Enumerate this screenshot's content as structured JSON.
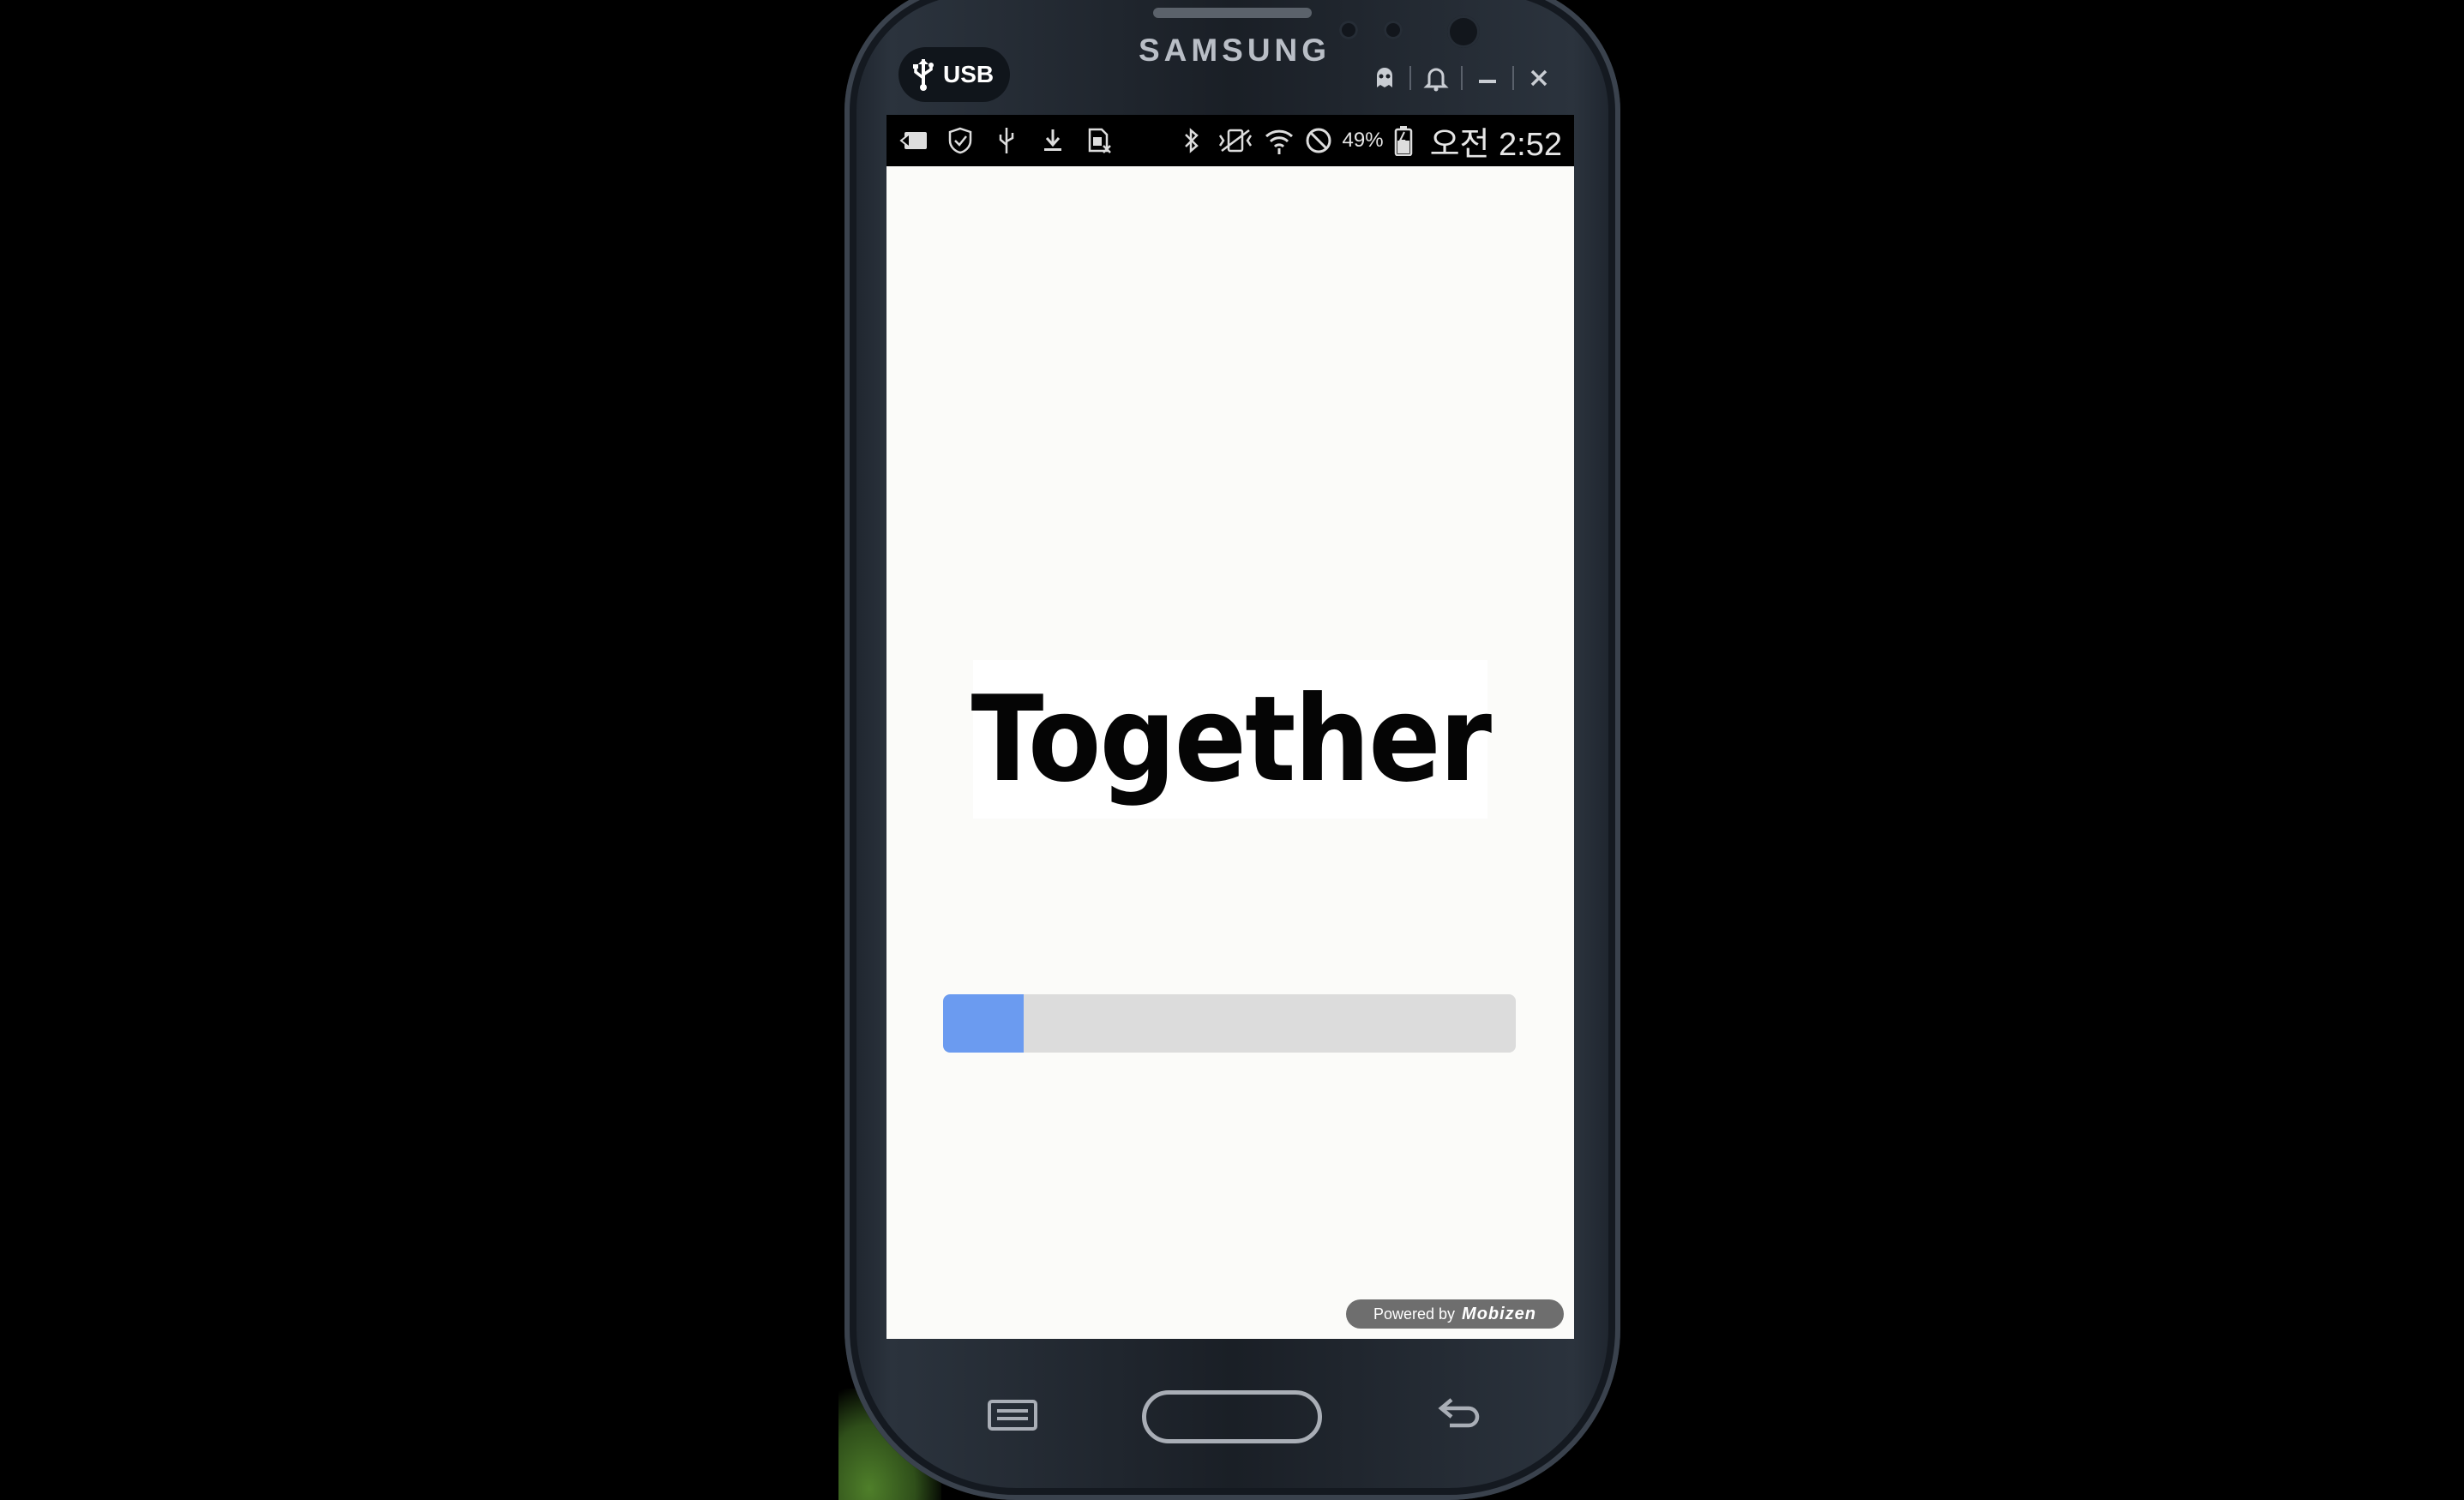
{
  "window": {
    "brand": "SAMSUNG",
    "connection_label": "USB",
    "controls": [
      "ghost-icon",
      "bell-icon",
      "minimize-icon",
      "close-icon"
    ]
  },
  "status_bar": {
    "left_icons": [
      "screen-mirror-icon",
      "shield-icon",
      "usb-icon",
      "download-icon",
      "sim-icon"
    ],
    "right_icons": [
      "bluetooth-icon",
      "vibrate-mute-icon",
      "wifi-icon",
      "no-signal-icon"
    ],
    "battery": "49%",
    "time": "오전 2:52"
  },
  "splash": {
    "title": "Together",
    "progress": 0.14,
    "colors": {
      "fill": "#6b9bf0",
      "track": "#dcdcdc"
    }
  },
  "badge": {
    "prefix": "Powered by",
    "brand": "Mobizen"
  },
  "nav": [
    "menu-key-icon",
    "home-key",
    "back-key-icon"
  ]
}
